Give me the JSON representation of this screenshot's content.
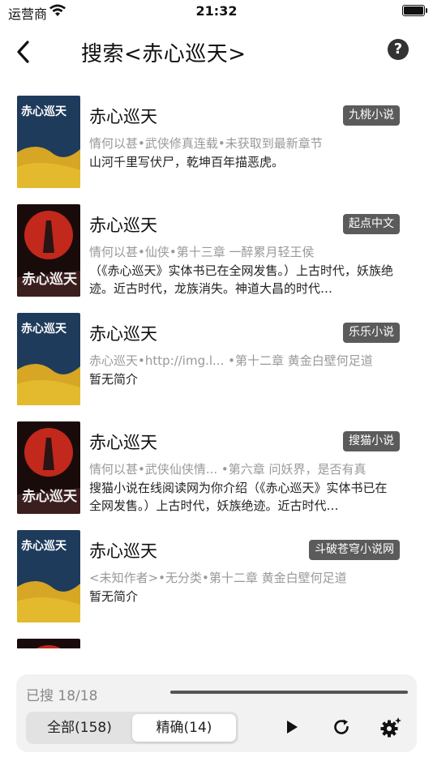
{
  "status_bar": {
    "carrier": "运营商",
    "time": "21:32"
  },
  "header": {
    "title": "搜索<赤心巡天>"
  },
  "results": [
    {
      "title": "赤心巡天",
      "source": "九桃小说",
      "meta": "情何以甚•武侠修真连载•未获取到最新章节",
      "desc": "山河千里写伏尸，乾坤百年描恶虎。",
      "cover": "blue"
    },
    {
      "title": "赤心巡天",
      "source": "起点中文",
      "meta": "情何以甚•仙侠•第十三章 一醉累月轻王侯",
      "desc": "（《赤心巡天》实体书已在全网发售。）上古时代，妖族绝迹。近古时代，龙族消失。神道大昌的时代…",
      "cover": "red"
    },
    {
      "title": "赤心巡天",
      "source": "乐乐小说",
      "meta": "赤心巡天•http://img.l... •第十二章 黄金白壁何足道",
      "desc": "暂无简介",
      "cover": "blue"
    },
    {
      "title": "赤心巡天",
      "source": "搜猫小说",
      "meta": "情何以甚•武侠仙侠情... •第六章 问妖界，是否有真",
      "desc": "搜猫小说在线阅读网为你介绍（《赤心巡天》实体书已在全网发售。）上古时代，妖族绝迹。近古时代…",
      "cover": "red"
    },
    {
      "title": "赤心巡天",
      "source": "斗破苍穹小说网",
      "meta": "<未知作者>•无分类•第十二章 黄金白壁何足道",
      "desc": "暂无简介",
      "cover": "blue"
    }
  ],
  "footer": {
    "searched_label": "已搜 18/18",
    "progress": 1.0,
    "tab_all": "全部(158)",
    "tab_exact": "精确(14)"
  }
}
